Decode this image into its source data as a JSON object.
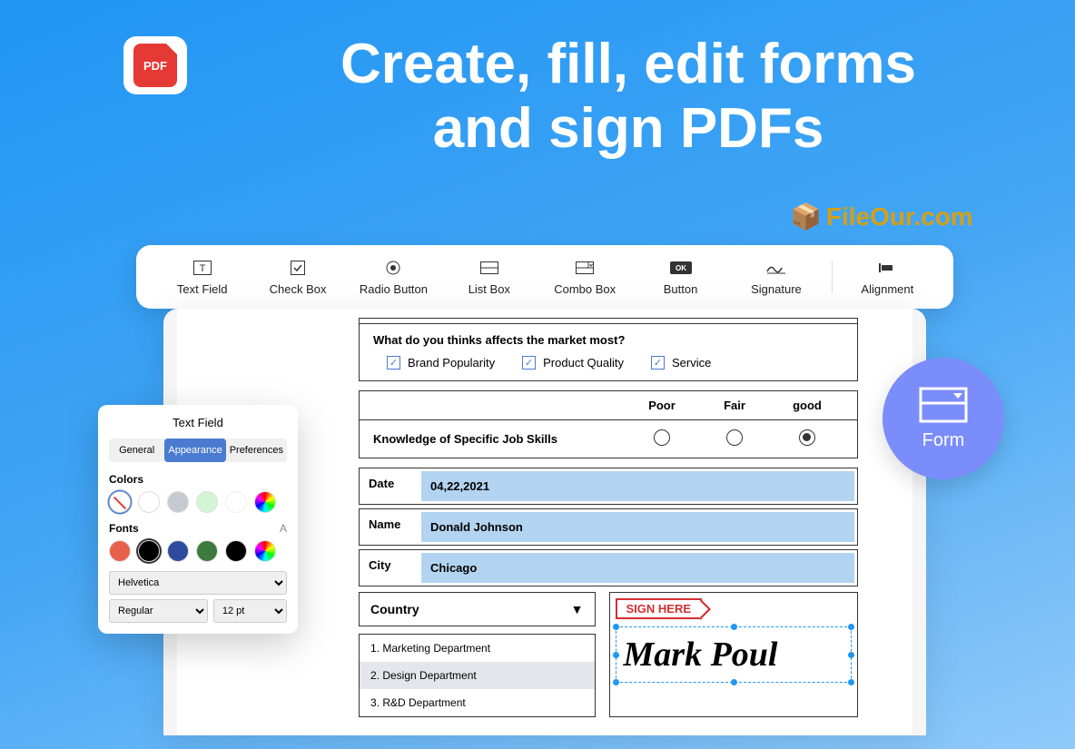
{
  "header": {
    "pdf_icon_text": "PDF",
    "title_line1": "Create, fill, edit forms",
    "title_line2": "and sign PDFs"
  },
  "watermark": "FileOur.com",
  "toolbar": {
    "items": [
      {
        "label": "Text Field"
      },
      {
        "label": "Check Box"
      },
      {
        "label": "Radio Button"
      },
      {
        "label": "List Box"
      },
      {
        "label": "Combo Box"
      },
      {
        "label": "Button"
      },
      {
        "label": "Signature"
      },
      {
        "label": "Alignment"
      }
    ]
  },
  "form": {
    "question": "What do you thinks affects the market most",
    "checks": [
      "Brand Popularity",
      "Product Quality",
      "Service"
    ],
    "rating": {
      "columns": [
        "Poor",
        "Fair",
        "good"
      ],
      "row_label": "Knowledge of Specific Job Skills",
      "selected": 2
    },
    "fields": {
      "date_label": "Date",
      "date_value": "04,22,2021",
      "name_label": "Name",
      "name_value": "Donald Johnson",
      "city_label": "City",
      "city_value": "Chicago"
    },
    "country_label": "Country",
    "departments": [
      "1. Marketing Department",
      "2. Design Department",
      "3. R&D Department"
    ],
    "dept_selected": 1,
    "sign_here": "SIGN HERE",
    "signature": "Mark Poul"
  },
  "panel": {
    "title": "Text Field",
    "tabs": [
      "General",
      "Appearance",
      "Preferences"
    ],
    "active_tab": 1,
    "colors_label": "Colors",
    "fonts_label": "Fonts",
    "font_family": "Helvetica",
    "font_weight": "Regular",
    "font_size": "12 pt"
  },
  "badge": {
    "label": "Form"
  }
}
